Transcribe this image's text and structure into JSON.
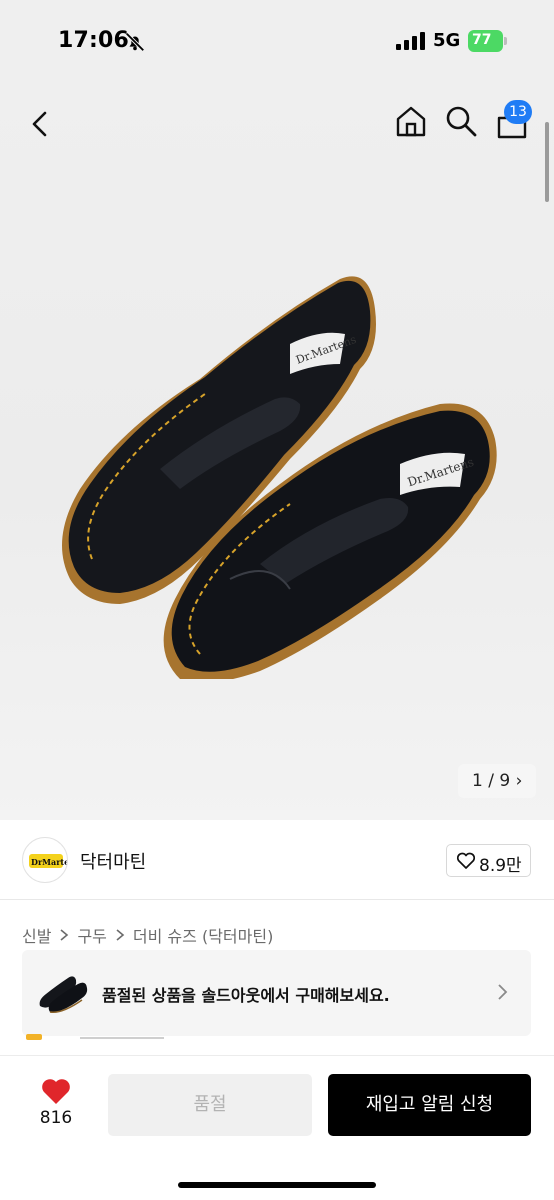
{
  "status_bar": {
    "time": "17:06",
    "network": "5G",
    "battery": "77"
  },
  "top_nav": {
    "cart_count": "13"
  },
  "gallery": {
    "page_indicator": "1 / 9"
  },
  "brand": {
    "name": "닥터마틴",
    "likes": "8.9만"
  },
  "breadcrumb": [
    "신발",
    "구두",
    "더비 슈즈 (닥터마틴)"
  ],
  "soldout_banner": {
    "text": "품절된 상품을 솔드아웃에서 구매해보세요."
  },
  "bottom_bar": {
    "wish_count": "816",
    "soldout_label": "품절",
    "restock_label": "재입고 알림 신청"
  },
  "colors": {
    "accent_blue": "#1f7cf5",
    "heart_red": "#e0262b",
    "battery_green": "#4cd964"
  }
}
